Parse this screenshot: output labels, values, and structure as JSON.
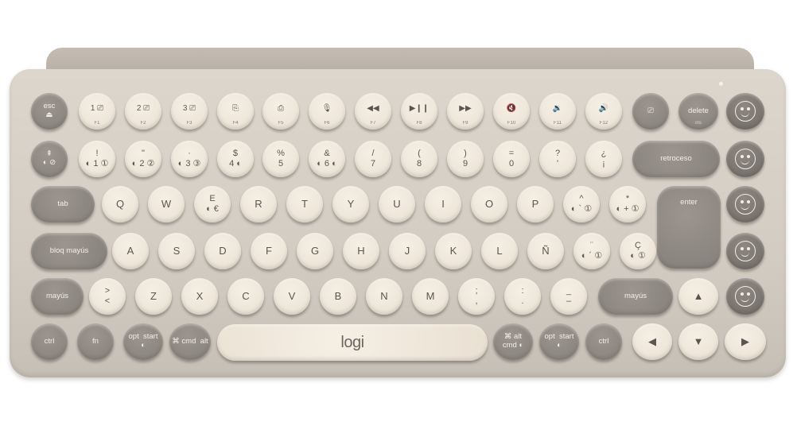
{
  "product": {
    "logo_text": "logi"
  },
  "colors": {
    "body": "#d8d1c7",
    "cream_key": "#efe7db",
    "gray_key": "#8c8680",
    "emoji_key": "#7c7670"
  },
  "rows": [
    [
      {
        "label": "esc\n⏏",
        "c": "gray",
        "name": "esc-key"
      },
      {
        "label": "1 ⎚",
        "sub": "F1",
        "c": "cream",
        "name": "f1-key",
        "fn": true
      },
      {
        "label": "2 ⎚",
        "sub": "F2",
        "c": "cream",
        "name": "f2-key",
        "fn": true
      },
      {
        "label": "3 ⎚",
        "sub": "F3",
        "c": "cream",
        "name": "f3-key",
        "fn": true
      },
      {
        "label": "⎘",
        "sub": "F4",
        "c": "cream",
        "name": "f4-key",
        "fn": true
      },
      {
        "label": "⎙",
        "sub": "F5",
        "c": "cream",
        "name": "f5-key",
        "fn": true
      },
      {
        "label": "🎙",
        "sub": "F6",
        "c": "cream",
        "name": "f6-key",
        "fn": true
      },
      {
        "label": "◀◀",
        "sub": "F7",
        "c": "cream",
        "name": "f7-key",
        "fn": true
      },
      {
        "label": "▶❙❙",
        "sub": "F8",
        "c": "cream",
        "name": "f8-key",
        "fn": true
      },
      {
        "label": "▶▶",
        "sub": "F9",
        "c": "cream",
        "name": "f9-key",
        "fn": true
      },
      {
        "label": "🔇",
        "sub": "F10",
        "c": "cream",
        "name": "f10-key",
        "fn": true
      },
      {
        "label": "🔉",
        "sub": "F11",
        "c": "cream",
        "name": "f11-key",
        "fn": true
      },
      {
        "label": "🔊",
        "sub": "F12",
        "c": "cream",
        "name": "f12-key",
        "fn": true
      },
      {
        "label": "⎚",
        "c": "gray",
        "name": "screenshot-key"
      },
      {
        "label": "delete",
        "sub": "ins",
        "c": "gray",
        "name": "delete-key"
      }
    ],
    [
      {
        "label": "⇞\n◐ ⊘",
        "c": "gray",
        "name": "degree-key"
      },
      {
        "label": "!\n◐ 1 ①",
        "c": "cream",
        "name": "key-1"
      },
      {
        "label": "\"\n◐ 2 ②",
        "c": "cream",
        "name": "key-2"
      },
      {
        "label": "·\n◐ 3 ③",
        "c": "cream",
        "name": "key-3"
      },
      {
        "label": "$\n4 ◐",
        "c": "cream",
        "name": "key-4"
      },
      {
        "label": "%\n5",
        "c": "cream",
        "name": "key-5"
      },
      {
        "label": "&\n◐ 6 ◐",
        "c": "cream",
        "name": "key-6"
      },
      {
        "label": "/\n7",
        "c": "cream",
        "name": "key-7"
      },
      {
        "label": "(\n8",
        "c": "cream",
        "name": "key-8"
      },
      {
        "label": ")\n9",
        "c": "cream",
        "name": "key-9"
      },
      {
        "label": "=\n0",
        "c": "cream",
        "name": "key-0"
      },
      {
        "label": "?\n'",
        "c": "cream",
        "name": "key-apostrophe"
      },
      {
        "label": "¿\n¡",
        "c": "cream",
        "name": "key-inverted-excl"
      },
      {
        "label": "retroceso",
        "c": "gray",
        "pill": true,
        "name": "backspace-key"
      }
    ],
    [
      {
        "label": "tab",
        "c": "gray",
        "pill": true,
        "name": "tab-key"
      },
      {
        "label": "Q",
        "c": "cream",
        "name": "key-q"
      },
      {
        "label": "W",
        "c": "cream",
        "name": "key-w"
      },
      {
        "label": "E\n◐ €",
        "c": "cream",
        "name": "key-e"
      },
      {
        "label": "R",
        "c": "cream",
        "name": "key-r"
      },
      {
        "label": "T",
        "c": "cream",
        "name": "key-t"
      },
      {
        "label": "Y",
        "c": "cream",
        "name": "key-y"
      },
      {
        "label": "U",
        "c": "cream",
        "name": "key-u"
      },
      {
        "label": "I",
        "c": "cream",
        "name": "key-i"
      },
      {
        "label": "O",
        "c": "cream",
        "name": "key-o"
      },
      {
        "label": "P",
        "c": "cream",
        "name": "key-p"
      },
      {
        "label": "^\n◐ ` ①",
        "c": "cream",
        "name": "key-grave"
      },
      {
        "label": "*\n◐ + ①",
        "c": "cream",
        "name": "key-plus"
      },
      {
        "label": "enter",
        "c": "gray",
        "name": "enter-key"
      }
    ],
    [
      {
        "label": "bloq mayús",
        "c": "gray",
        "pill": true,
        "name": "caps-lock-key"
      },
      {
        "label": "A",
        "c": "cream",
        "name": "key-a"
      },
      {
        "label": "S",
        "c": "cream",
        "name": "key-s"
      },
      {
        "label": "D",
        "c": "cream",
        "name": "key-d"
      },
      {
        "label": "F",
        "c": "cream",
        "name": "key-f"
      },
      {
        "label": "G",
        "c": "cream",
        "name": "key-g"
      },
      {
        "label": "H",
        "c": "cream",
        "name": "key-h"
      },
      {
        "label": "J",
        "c": "cream",
        "name": "key-j"
      },
      {
        "label": "K",
        "c": "cream",
        "name": "key-k"
      },
      {
        "label": "L",
        "c": "cream",
        "name": "key-l"
      },
      {
        "label": "Ñ",
        "c": "cream",
        "name": "key-n-tilde"
      },
      {
        "label": "¨\n◐ ´ ①",
        "c": "cream",
        "name": "key-acute"
      },
      {
        "label": "Ç\n◐ ①",
        "c": "cream",
        "name": "key-c-cedilla"
      }
    ],
    [
      {
        "label": "mayús",
        "c": "gray",
        "pill": true,
        "name": "left-shift-key"
      },
      {
        "label": ">\n<",
        "c": "cream",
        "name": "key-less-than"
      },
      {
        "label": "Z",
        "c": "cream",
        "name": "key-z"
      },
      {
        "label": "X",
        "c": "cream",
        "name": "key-x"
      },
      {
        "label": "C",
        "c": "cream",
        "name": "key-c"
      },
      {
        "label": "V",
        "c": "cream",
        "name": "key-v"
      },
      {
        "label": "B",
        "c": "cream",
        "name": "key-b"
      },
      {
        "label": "N",
        "c": "cream",
        "name": "key-n"
      },
      {
        "label": "M",
        "c": "cream",
        "name": "key-m"
      },
      {
        "label": ";\n,",
        "c": "cream",
        "name": "key-comma"
      },
      {
        "label": ":\n.",
        "c": "cream",
        "name": "key-period"
      },
      {
        "label": "_\n–",
        "c": "cream",
        "name": "key-hyphen"
      },
      {
        "label": "mayús",
        "c": "gray",
        "pill": true,
        "name": "right-shift-key"
      },
      {
        "label": "▲",
        "c": "cream",
        "name": "arrow-up-key"
      }
    ],
    [
      {
        "label": "ctrl",
        "c": "gray",
        "name": "left-ctrl-key"
      },
      {
        "label": "fn",
        "c": "gray",
        "name": "fn-key"
      },
      {
        "label": "opt  start\n◐",
        "c": "gray",
        "name": "left-opt-key"
      },
      {
        "label": "⌘ cmd  alt",
        "c": "gray",
        "name": "left-cmd-key"
      },
      {
        "label": "logi",
        "c": "cream",
        "pill": true,
        "name": "space-bar",
        "logo": true
      },
      {
        "label": "⌘ alt\ncmd ◐",
        "c": "gray",
        "name": "right-cmd-key"
      },
      {
        "label": "opt  start\n◐",
        "c": "gray",
        "name": "right-opt-key"
      },
      {
        "label": "ctrl",
        "c": "gray",
        "name": "right-ctrl-key"
      },
      {
        "label": "◀",
        "c": "cream",
        "name": "arrow-left-key"
      },
      {
        "label": "▼",
        "c": "cream",
        "name": "arrow-down-key"
      },
      {
        "label": "▶",
        "c": "cream",
        "name": "arrow-right-key"
      }
    ]
  ],
  "emoji_column": [
    {
      "name": "emoji-key-1",
      "glyph": "laugh-icon"
    },
    {
      "name": "emoji-key-2",
      "glyph": "party-icon"
    },
    {
      "name": "emoji-key-3",
      "glyph": "heart-eyes-icon"
    },
    {
      "name": "emoji-key-4",
      "glyph": "cry-laugh-icon"
    },
    {
      "name": "emoji-key-5",
      "glyph": "emoji-menu-icon"
    }
  ]
}
